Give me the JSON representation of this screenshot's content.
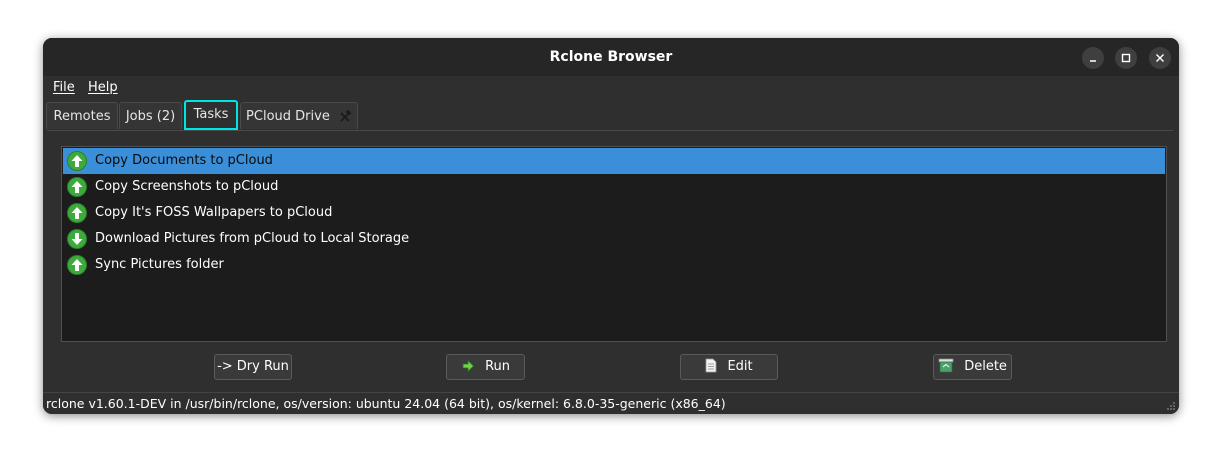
{
  "window": {
    "title": "Rclone Browser"
  },
  "menu": {
    "items": [
      {
        "label": "File"
      },
      {
        "label": "Help"
      }
    ]
  },
  "tabs": [
    {
      "label": "Remotes"
    },
    {
      "label": "Jobs (2)"
    },
    {
      "label": "Tasks",
      "active": true
    },
    {
      "label": "PCloud Drive"
    }
  ],
  "tasks": [
    {
      "label": "Copy Documents to pCloud",
      "icon": "arrow-up-icon",
      "selected": true
    },
    {
      "label": "Copy Screenshots to pCloud",
      "icon": "arrow-up-icon"
    },
    {
      "label": "Copy It's FOSS Wallpapers to pCloud",
      "icon": "arrow-up-icon"
    },
    {
      "label": "Download Pictures from pCloud to Local Storage",
      "icon": "arrow-down-icon"
    },
    {
      "label": "Sync Pictures folder",
      "icon": "arrow-up-icon"
    }
  ],
  "actions": {
    "dry_run": "-> Dry Run",
    "run": "Run",
    "edit": "Edit",
    "delete": "Delete"
  },
  "status": {
    "text": "rclone v1.60.1-DEV in /usr/bin/rclone, os/version: ubuntu 24.04 (64 bit), os/kernel: 6.8.0-35-generic (x86_64)"
  },
  "colors": {
    "accent": "#00e5e5",
    "selection": "#3a8fd8",
    "icon_green": "#3cab3c"
  }
}
